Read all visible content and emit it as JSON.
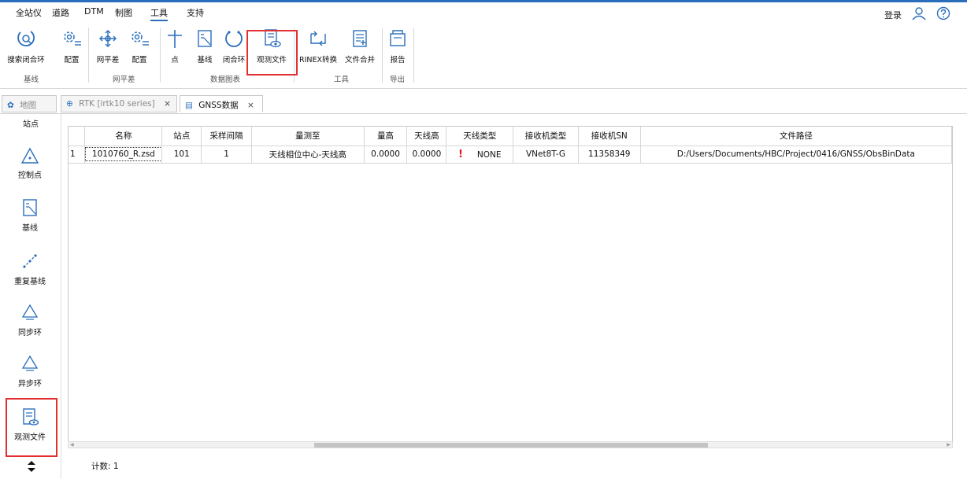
{
  "menu": {
    "items": [
      "全站仪",
      "道路",
      "DTM",
      "制图",
      "工具",
      "支持"
    ],
    "active_index": 4,
    "login": "登录"
  },
  "ribbon": {
    "buttons": [
      "搜索闭合环",
      "配置",
      "网平差",
      "配置",
      "点",
      "基线",
      "闭合环",
      "观测文件",
      "RINEX转换",
      "文件合并",
      "报告"
    ],
    "groups": [
      "基线",
      "网平差",
      "数据图表",
      "工具",
      "导出"
    ],
    "highlighted": "观测文件"
  },
  "tabs": [
    {
      "label": "地图",
      "active": false,
      "closable": false
    },
    {
      "label": "RTK [irtk10 series]",
      "active": false,
      "closable": true
    },
    {
      "label": "GNSS数据",
      "active": true,
      "closable": true
    }
  ],
  "sidebar": {
    "top_label": "站点",
    "items": [
      "控制点",
      "基线",
      "重复基线",
      "同步环",
      "异步环",
      "观测文件"
    ],
    "selected": "观测文件"
  },
  "table": {
    "columns": [
      "",
      "名称",
      "站点",
      "采样间隔",
      "量测至",
      "量高",
      "天线高",
      "天线类型",
      "接收机类型",
      "接收机SN",
      "文件路径"
    ],
    "rows": [
      [
        "1",
        "1010760_R.zsd",
        "101",
        "1",
        "天线相位中心-天线高",
        "0.0000",
        "0.0000",
        "NONE",
        "VNet8T-G",
        "11358349",
        "D:/Users/Documents/HBC/Project/0416/GNSS/ObsBinData"
      ]
    ],
    "warning_mark": "!"
  },
  "status": {
    "count_label": "计数: 1"
  },
  "colors": {
    "accent": "#2a6ebb",
    "highlight": "#e23030",
    "warning": "#e01818"
  }
}
